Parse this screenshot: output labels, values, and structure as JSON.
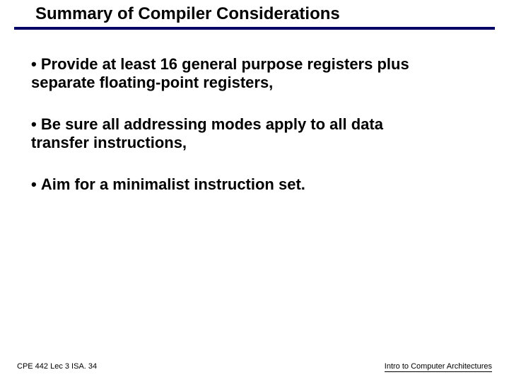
{
  "title": "Summary of Compiler Considerations",
  "bullets": [
    "Provide at least 16 general purpose registers plus separate floating-point registers,",
    "Be sure all addressing modes apply to all data transfer instructions,",
    "Aim for a minimalist instruction set."
  ],
  "footer": {
    "left": "CPE 442  Lec 3 ISA. 34",
    "right": "Intro to Computer Architectures"
  }
}
